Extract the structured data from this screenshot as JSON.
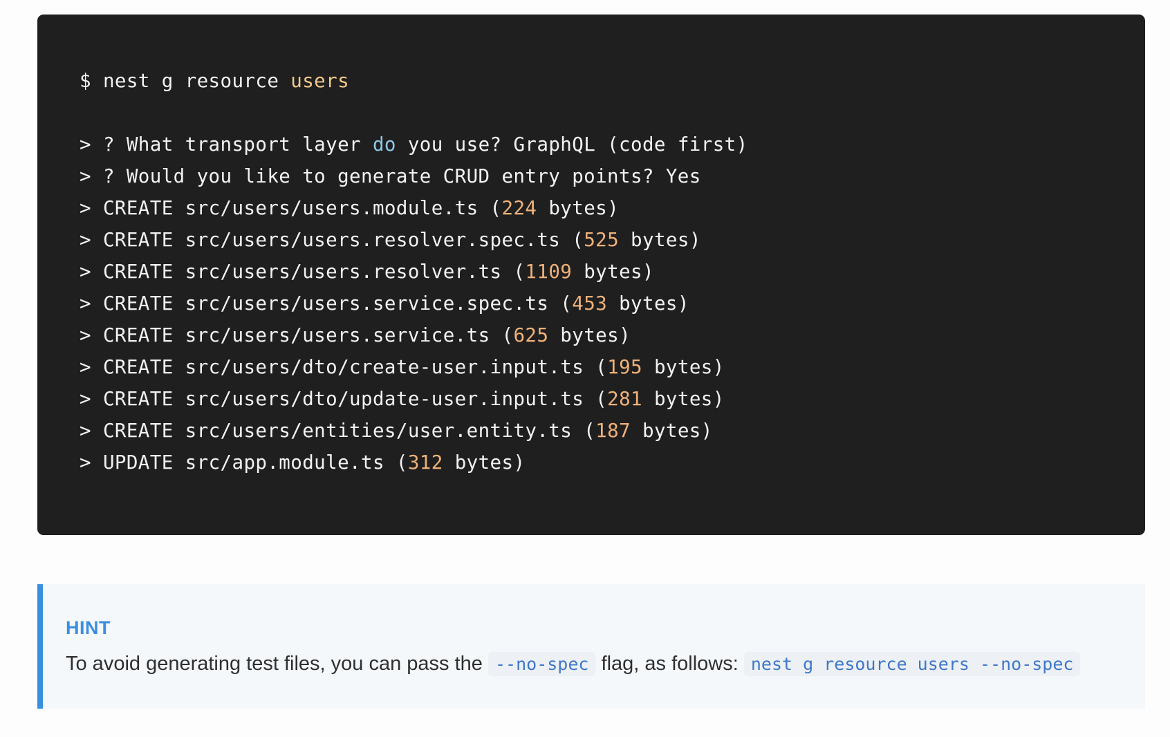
{
  "terminal": {
    "command": {
      "prompt": "$",
      "cmd": "nest g resource",
      "arg": "users"
    },
    "questions": [
      {
        "marker": ">",
        "pre": "? What transport layer",
        "kw": "do",
        "post": "you use? GraphQL (code first)"
      },
      {
        "marker": ">",
        "text": "? Would you like to generate CRUD entry points? Yes"
      }
    ],
    "files": [
      {
        "marker": ">",
        "action": "CREATE",
        "path": "src/users/users.module.ts",
        "size": "224",
        "unit": "bytes"
      },
      {
        "marker": ">",
        "action": "CREATE",
        "path": "src/users/users.resolver.spec.ts",
        "size": "525",
        "unit": "bytes"
      },
      {
        "marker": ">",
        "action": "CREATE",
        "path": "src/users/users.resolver.ts",
        "size": "1109",
        "unit": "bytes"
      },
      {
        "marker": ">",
        "action": "CREATE",
        "path": "src/users/users.service.spec.ts",
        "size": "453",
        "unit": "bytes"
      },
      {
        "marker": ">",
        "action": "CREATE",
        "path": "src/users/users.service.ts",
        "size": "625",
        "unit": "bytes"
      },
      {
        "marker": ">",
        "action": "CREATE",
        "path": "src/users/dto/create-user.input.ts",
        "size": "195",
        "unit": "bytes"
      },
      {
        "marker": ">",
        "action": "CREATE",
        "path": "src/users/dto/update-user.input.ts",
        "size": "281",
        "unit": "bytes"
      },
      {
        "marker": ">",
        "action": "CREATE",
        "path": "src/users/entities/user.entity.ts",
        "size": "187",
        "unit": "bytes"
      },
      {
        "marker": ">",
        "action": "UPDATE",
        "path": "src/app.module.ts",
        "size": "312",
        "unit": "bytes"
      }
    ]
  },
  "hint": {
    "title": "HINT",
    "text_before": "To avoid generating test files, you can pass the",
    "code1": "--no-spec",
    "text_middle": "flag, as follows:",
    "code2": "nest g resource users --no-spec"
  },
  "colors": {
    "terminal_bg": "#1f1f1f",
    "terminal_text": "#f2f2f2",
    "keyword": "#f2c98a",
    "keyword_blue": "#8fc9e8",
    "number": "#f0b27a",
    "hint_accent": "#3a8ee0",
    "hint_bg": "#f5f8fb",
    "code_text": "#3f78c8"
  }
}
